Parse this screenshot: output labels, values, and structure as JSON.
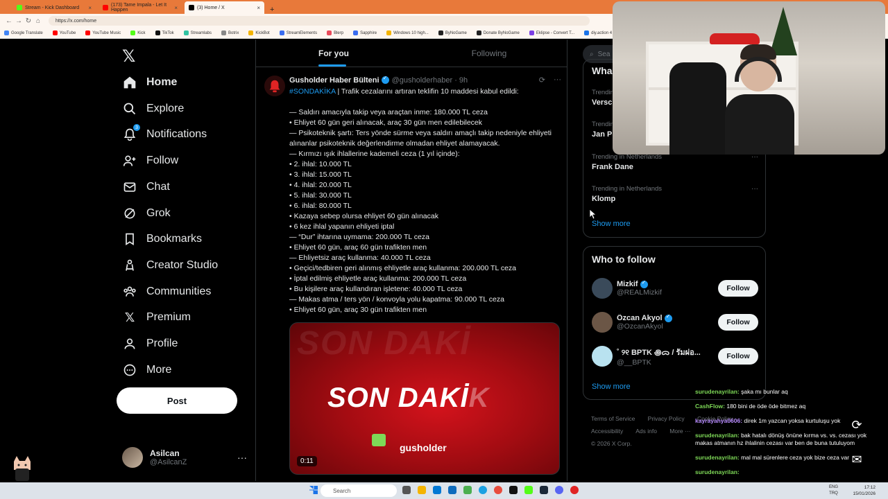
{
  "browser": {
    "tabs": [
      {
        "label": "Stream - Kick Dashboard",
        "color": "#53fc18"
      },
      {
        "label": "(173) Tame Impala - Let It Happen",
        "color": "#ff0000"
      },
      {
        "label": "(3) Home / X",
        "color": "#000000"
      }
    ],
    "url": "https://x.com/home",
    "bookmarks": [
      "Google Translate",
      "YouTube",
      "YouTube Music",
      "Kick",
      "TikTok",
      "Streamlabs",
      "Botrix",
      "KickBot",
      "StreamElements",
      "Blerp",
      "Sapphire",
      "Windows 10 high...",
      "ByNoGame",
      "Donate ByNoGame",
      "Eklipse - Convert T...",
      "diy.action 4 - ..."
    ]
  },
  "nav": {
    "items": [
      {
        "label": "Home",
        "icon": "home-icon"
      },
      {
        "label": "Explore",
        "icon": "search-icon"
      },
      {
        "label": "Notifications",
        "icon": "bell-icon",
        "badge": "3"
      },
      {
        "label": "Follow",
        "icon": "add-person-icon"
      },
      {
        "label": "Chat",
        "icon": "mail-icon"
      },
      {
        "label": "Grok",
        "icon": "grok-icon"
      },
      {
        "label": "Bookmarks",
        "icon": "bookmark-icon"
      },
      {
        "label": "Creator Studio",
        "icon": "creator-icon"
      },
      {
        "label": "Communities",
        "icon": "communities-icon"
      },
      {
        "label": "Premium",
        "icon": "x-logo-icon"
      },
      {
        "label": "Profile",
        "icon": "person-icon"
      },
      {
        "label": "More",
        "icon": "more-circle-icon"
      }
    ],
    "post_label": "Post",
    "account": {
      "name": "Asilcan",
      "handle": "@AsilcanZ"
    }
  },
  "feed": {
    "tabs": [
      "For you",
      "Following"
    ],
    "tweet": {
      "name": "Gusholder Haber Bülteni",
      "handle": "@gusholderhaber",
      "time": "· 9h",
      "hashtag": "#SONDAKİKA",
      "headline": " | Trafik cezalarını artıran teklifin 10 maddesi kabul edildi:",
      "lines": [
        "—  Saldırı amacıyla takip veya araçtan inme: 180.000 TL ceza",
        "• Ehliyet 60 gün geri alınacak, araç 30 gün men edilebilecek",
        "—  Psikoteknik şartı: Ters yönde sürme veya saldırı amaçlı takip nedeniyle ehliyeti alınanlar psikoteknik değerlendirme olmadan ehliyet alamayacak.",
        "— Kırmızı ışık ihlallerine kademeli ceza (1 yıl içinde):",
        "• 2. ihlal: 10.000 TL",
        "• 3. ihlal: 15.000 TL",
        "• 4. ihlal: 20.000 TL",
        "• 5. ihlal: 30.000 TL",
        "• 6. ihlal: 80.000 TL",
        "• Kazaya sebep olursa ehliyet 60 gün alınacak",
        "• 6 kez ihlal yapanın ehliyeti iptal",
        "—  “Dur” ihtarına uymama: 200.000 TL ceza",
        "• Ehliyet 60 gün, araç 60 gün trafikten men",
        "—  Ehliyetsiz araç kullanma: 40.000 TL ceza",
        "• Geçici/tedbiren geri alınmış ehliyetle araç kullanma: 200.000 TL ceza",
        "• İptal edilmiş ehliyetle araç kullanma: 200.000 TL ceza",
        "• Bu kişilere araç kullandıran işletene: 40.000 TL ceza",
        "—  Makas atma / ters yön / konvoyla yolu kapatma: 90.000 TL ceza",
        "• Ehliyet 60 gün, araç 30 gün trafikten men"
      ],
      "media": {
        "ghost": "SON DAKİ",
        "title": "SON DAKİ",
        "title_fade": "K",
        "brand": "gusholder",
        "duration": "0:11"
      }
    }
  },
  "right": {
    "search_placeholder": "Sea",
    "trends_title": "Wha",
    "trends": [
      {
        "context": "Trendin",
        "name": "Versc"
      },
      {
        "context": "Trendin",
        "name": "Jan P"
      },
      {
        "context": "Trending in Netherlands",
        "name": "Frank Dane"
      },
      {
        "context": "Trending in Netherlands",
        "name": "Klomp"
      }
    ],
    "show_more": "Show more",
    "wtf_title": "Who to follow",
    "wtf": [
      {
        "name": "Mizkif",
        "handle": "@REALMizkif",
        "verified": true,
        "color": "#3a4a5a"
      },
      {
        "name": "Özcan Akyol",
        "handle": "@OzcanAkyol",
        "verified": true,
        "color": "#5a4a3a"
      },
      {
        "name": "˚ ୨୧ BPTK ꩜ᯅ / รัมผ่อ...",
        "handle": "@__BPTK",
        "verified": false,
        "color": "#b9e2f0"
      }
    ],
    "follow_label": "Follow",
    "footer": [
      "Terms of Service",
      "Privacy Policy",
      "Cookie Policy",
      "Accessibility",
      "Ads info",
      "More ···",
      "© 2026 X Corp."
    ]
  },
  "chat": [
    {
      "user": "surudenayrilan:",
      "text": " şaka mı bunlar aq",
      "style": "green"
    },
    {
      "user": "CashFlow:",
      "text": " 180 bini de öde öde bitmez aq",
      "style": "green"
    },
    {
      "user": "kayrayahya0606:",
      "text": " direk 1m yazcan yoksa kurtuluşu yok",
      "style": "purple"
    },
    {
      "user": "surudenayrilan:",
      "text": " bak hatalı dönüş önüne kırma vs. vs. cezası yok makas atmanın hz ihlalinin cezası var ben de buna tutuluyom",
      "style": "green"
    },
    {
      "user": "surudenayrilan:",
      "text": " mal mal sürenlere ceza yok bize ceza var",
      "style": "green"
    },
    {
      "user": "surudenayrilan:",
      "text": "",
      "style": "green"
    }
  ],
  "taskbar": {
    "search": "Search",
    "lang": "ENG",
    "lang2": "TRQ",
    "time": "17:12",
    "date": "15/01/2026"
  }
}
